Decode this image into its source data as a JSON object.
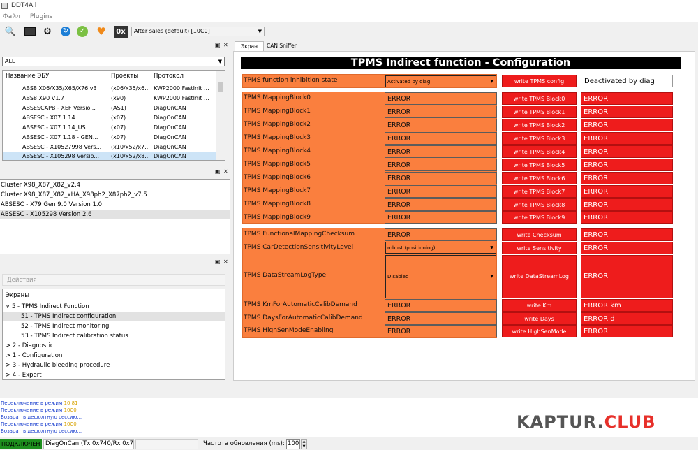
{
  "window": {
    "title": "DDT4All"
  },
  "menu": [
    "Файл",
    "Plugins"
  ],
  "toolbar": {
    "icons": [
      "scan-icon",
      "dashboard-icon",
      "settings-gear-icon",
      "refresh-icon",
      "connect-icon",
      "heart-icon",
      "hex-icon"
    ],
    "hex_label": "0x",
    "ecu_selected": "After sales (default) [10C0]"
  },
  "ecu_panel": {
    "filter": "ALL",
    "headers": [
      "Название ЭБУ",
      "Проекты",
      "Протокол"
    ],
    "rows": [
      [
        "ABS8 X06/X35/X65/X76 v3",
        "(x06/x35/x6...",
        "KWP2000 FastInit ..."
      ],
      [
        "ABS8 X90 V1.7",
        "(x90)",
        "KWP2000 FastInit ..."
      ],
      [
        "ABSESCAPB - XEF Versio...",
        "(AS1)",
        "DiagOnCAN"
      ],
      [
        "ABSESC - X07 1.14",
        "(x07)",
        "DiagOnCAN"
      ],
      [
        "ABSESC - X07 1.14_US",
        "(x07)",
        "DiagOnCAN"
      ],
      [
        "ABSESC - X07 1.18 - GEN...",
        "(x07)",
        "DiagOnCAN"
      ],
      [
        "ABSESC - X10527998 Vers...",
        "(x10/x52/x7...",
        "DiagOnCAN"
      ],
      [
        "ABSESC - X105298 Versio...",
        "(x10/x52/x8...",
        "DiagOnCAN"
      ]
    ]
  },
  "project_panel": {
    "items": [
      "Cluster X98_X87_X82_v2.4",
      "Cluster X98_X87_X82_xHA_X98ph2_X87ph2_v7.5",
      "ABSESC - X79 Gen 9.0 Version 1.0",
      "ABSESC - X105298 Version 2.6"
    ]
  },
  "actions_panel": {
    "actions_label": "Действия",
    "screens_label": "Экраны",
    "tree": [
      {
        "text": "5 - TPMS Indirect Function",
        "level": 0,
        "expander": "∨"
      },
      {
        "text": "51 - TPMS Indirect configuration",
        "level": 1,
        "expander": ""
      },
      {
        "text": "52 - TPMS Indirect monitoring",
        "level": 1,
        "expander": ""
      },
      {
        "text": "53 - TPMS Indirect calibration status",
        "level": 1,
        "expander": ""
      },
      {
        "text": "2 - Diagnostic",
        "level": 0,
        "expander": ">"
      },
      {
        "text": "1 - Configuration",
        "level": 0,
        "expander": ">"
      },
      {
        "text": "3 - Hydraulic bleeding procedure",
        "level": 0,
        "expander": ">"
      },
      {
        "text": "4 - Expert",
        "level": 0,
        "expander": ">"
      }
    ]
  },
  "tabs": [
    "Экран",
    "CAN Sniffer"
  ],
  "screen": {
    "title": "TPMS Indirect function - Configuration",
    "inhibition": {
      "label": "TPMS function inhibition state",
      "value": "Activated by diag",
      "button": "write TPMS config",
      "result": "Deactivated by diag"
    },
    "mapping": [
      {
        "label": "TPMS MappingBlock0",
        "value": "ERROR",
        "button": "write TPMS Block0",
        "result": "ERROR"
      },
      {
        "label": "TPMS MappingBlock1",
        "value": "ERROR",
        "button": "write TPMS Block1",
        "result": "ERROR"
      },
      {
        "label": "TPMS MappingBlock2",
        "value": "ERROR",
        "button": "write TPMS Block2",
        "result": "ERROR"
      },
      {
        "label": "TPMS MappingBlock3",
        "value": "ERROR",
        "button": "write TPMS Block3",
        "result": "ERROR"
      },
      {
        "label": "TPMS MappingBlock4",
        "value": "ERROR",
        "button": "write TPMS Block4",
        "result": "ERROR"
      },
      {
        "label": "TPMS MappingBlock5",
        "value": "ERROR",
        "button": "write TPMS Block5",
        "result": "ERROR"
      },
      {
        "label": "TPMS MappingBlock6",
        "value": "ERROR",
        "button": "write TPMS Block6",
        "result": "ERROR"
      },
      {
        "label": "TPMS MappingBlock7",
        "value": "ERROR",
        "button": "write TPMS Block7",
        "result": "ERROR"
      },
      {
        "label": "TPMS MappingBlock8",
        "value": "ERROR",
        "button": "write TPMS Block8",
        "result": "ERROR"
      },
      {
        "label": "TPMS MappingBlock9",
        "value": "ERROR",
        "button": "write TPMS Block9",
        "result": "ERROR"
      }
    ],
    "params": {
      "checksum": {
        "label": "TPMS FunctionalMappingChecksum",
        "value": "ERROR",
        "button": "write Checksum",
        "result": "ERROR"
      },
      "sensitivity": {
        "label": "TPMS CarDetectionSensitivityLevel",
        "value": "robust (positioning)",
        "button": "write Sensitivity",
        "result": "ERROR"
      },
      "datastream": {
        "label": "TPMS DataStreamLogType",
        "value": "Disabled",
        "button": "write DataStreamLog",
        "result": "ERROR"
      },
      "km": {
        "label": "TPMS KmForAutomaticCalibDemand",
        "value": "ERROR",
        "button": "write Km",
        "result": "ERROR km"
      },
      "days": {
        "label": "TPMS DaysForAutomaticCalibDemand",
        "value": "ERROR",
        "button": "write Days",
        "result": "ERROR d"
      },
      "highsen": {
        "label": "TPMS HighSenModeEnabling",
        "value": "ERROR",
        "button": "write HighSenMode",
        "result": "ERROR"
      }
    }
  },
  "log": [
    {
      "prefix": "Переключение в режим ",
      "code": "10 81"
    },
    {
      "prefix": "Переключение в режим ",
      "code": "10C0"
    },
    {
      "prefix": "Возврат в дефолтную сессию...",
      "code": ""
    },
    {
      "prefix": "Переключение в режим ",
      "code": "10C0"
    },
    {
      "prefix": "Возврат в дефолтную сессию...",
      "code": ""
    }
  ],
  "status": {
    "connection": "ПОДКЛЮЧЕН",
    "protocol": "DiagOnCan (Tx 0x740/Rx 0x76",
    "rate_label": "Частота обновления (ms):",
    "rate_value": "100"
  },
  "watermark": {
    "part1": "KAPTUR.",
    "part2": "CLUB"
  },
  "colors": {
    "orange": "#fa7f3e",
    "red": "#ee1c1c",
    "connected_green": "#1e8f1e"
  }
}
